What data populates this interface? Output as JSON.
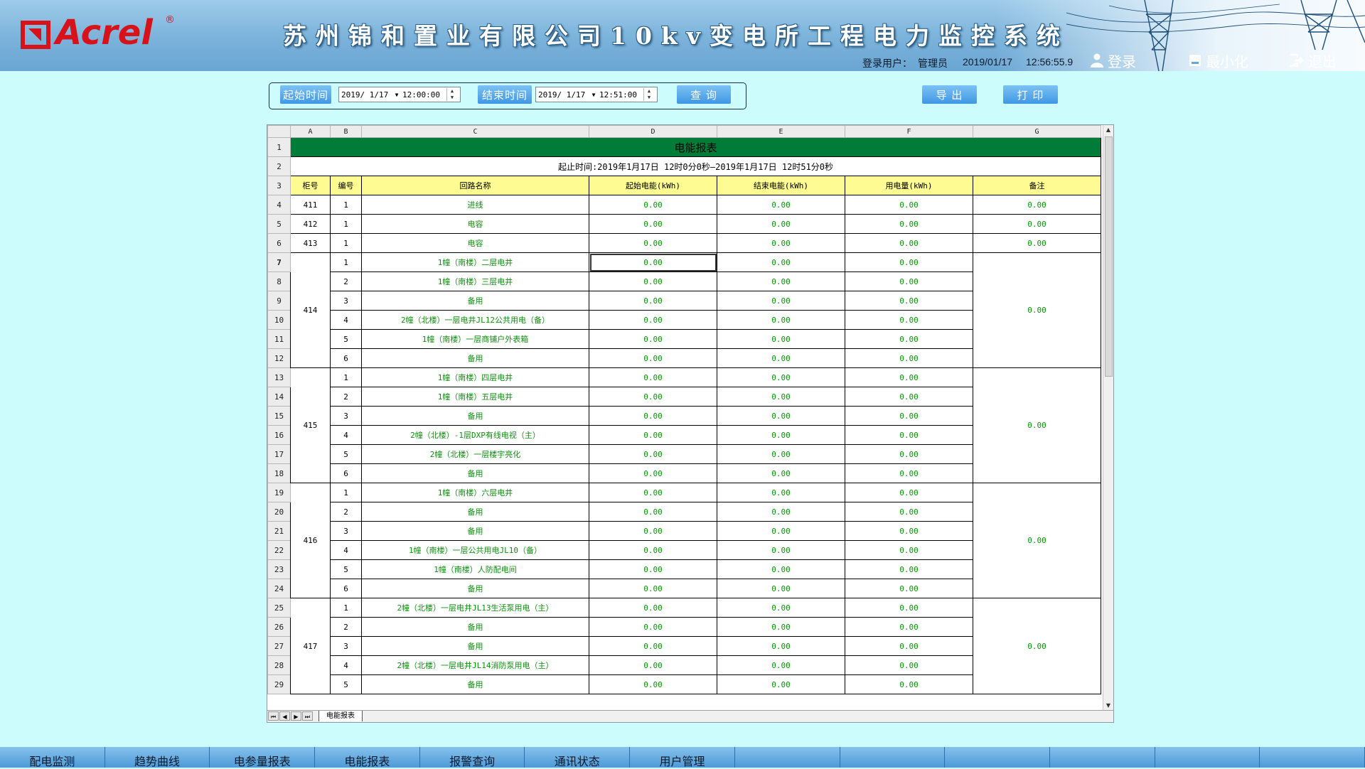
{
  "header": {
    "logo_text": "Acrel",
    "logo_registered": "®",
    "title": "苏州锦和置业有限公司10kv变电所工程电力监控系统",
    "user_label": "登录用户：",
    "user_name": "管理员",
    "date": "2019/01/17",
    "time": "12:56:55.9",
    "login_label": "登录",
    "minimize_label": "最小化",
    "exit_label": "退出"
  },
  "query": {
    "start_label": "起始时间",
    "start_date": "2019/ 1/17",
    "start_time": "12:00:00",
    "end_label": "结束时间",
    "end_date": "2019/ 1/17",
    "end_time": "12:51:00",
    "query_button": "查 询",
    "export_button": "导 出",
    "print_button": "打 印"
  },
  "sheet": {
    "column_letters": [
      "A",
      "B",
      "C",
      "D",
      "E",
      "F",
      "G"
    ],
    "title": "电能报表",
    "period": "起止时间:2019年1月17日  12时0分0秒—2019年1月17日  12时51分0秒",
    "headers": [
      "柜号",
      "编号",
      "回路名称",
      "起始电能(kWh)",
      "结束电能(kWh)",
      "用电量(kWh)",
      "备注"
    ],
    "rows": [
      {
        "row": "4",
        "cab": "411",
        "no": "1",
        "name": "进线",
        "start": "0.00",
        "end": "0.00",
        "used": "0.00",
        "remark": "0.00"
      },
      {
        "row": "5",
        "cab": "412",
        "no": "1",
        "name": "电容",
        "start": "0.00",
        "end": "0.00",
        "used": "0.00",
        "remark": "0.00"
      },
      {
        "row": "6",
        "cab": "413",
        "no": "1",
        "name": "电容",
        "start": "0.00",
        "end": "0.00",
        "used": "0.00",
        "remark": "0.00"
      },
      {
        "row": "7",
        "cab": "414",
        "no": "1",
        "name": "1幢（南楼）二层电井",
        "start": "0.00",
        "end": "0.00",
        "used": "0.00",
        "remark": "0.00"
      },
      {
        "row": "8",
        "no": "2",
        "name": "1幢（南楼）三层电井",
        "start": "0.00",
        "end": "0.00",
        "used": "0.00"
      },
      {
        "row": "9",
        "no": "3",
        "name": "备用",
        "start": "0.00",
        "end": "0.00",
        "used": "0.00"
      },
      {
        "row": "10",
        "no": "4",
        "name": "2幢（北楼）一层电井JL12公共用电（备）",
        "start": "0.00",
        "end": "0.00",
        "used": "0.00"
      },
      {
        "row": "11",
        "no": "5",
        "name": "1幢（南楼）一层商铺户外表箱",
        "start": "0.00",
        "end": "0.00",
        "used": "0.00"
      },
      {
        "row": "12",
        "no": "6",
        "name": "备用",
        "start": "0.00",
        "end": "0.00",
        "used": "0.00"
      },
      {
        "row": "13",
        "cab": "415",
        "no": "1",
        "name": "1幢（南楼）四层电井",
        "start": "0.00",
        "end": "0.00",
        "used": "0.00",
        "remark": "0.00"
      },
      {
        "row": "14",
        "no": "2",
        "name": "1幢（南楼）五层电井",
        "start": "0.00",
        "end": "0.00",
        "used": "0.00"
      },
      {
        "row": "15",
        "no": "3",
        "name": "备用",
        "start": "0.00",
        "end": "0.00",
        "used": "0.00"
      },
      {
        "row": "16",
        "no": "4",
        "name": "2幢（北楼）-1层DXP有线电视（主）",
        "start": "0.00",
        "end": "0.00",
        "used": "0.00"
      },
      {
        "row": "17",
        "no": "5",
        "name": "2幢（北楼）一层楼宇亮化",
        "start": "0.00",
        "end": "0.00",
        "used": "0.00"
      },
      {
        "row": "18",
        "no": "6",
        "name": "备用",
        "start": "0.00",
        "end": "0.00",
        "used": "0.00"
      },
      {
        "row": "19",
        "cab": "416",
        "no": "1",
        "name": "1幢（南楼）六层电井",
        "start": "0.00",
        "end": "0.00",
        "used": "0.00",
        "remark": "0.00"
      },
      {
        "row": "20",
        "no": "2",
        "name": "备用",
        "start": "0.00",
        "end": "0.00",
        "used": "0.00"
      },
      {
        "row": "21",
        "no": "3",
        "name": "备用",
        "start": "0.00",
        "end": "0.00",
        "used": "0.00"
      },
      {
        "row": "22",
        "no": "4",
        "name": "1幢（南楼）一层公共用电JL10（备）",
        "start": "0.00",
        "end": "0.00",
        "used": "0.00"
      },
      {
        "row": "23",
        "no": "5",
        "name": "1幢（南楼）人防配电间",
        "start": "0.00",
        "end": "0.00",
        "used": "0.00"
      },
      {
        "row": "24",
        "no": "6",
        "name": "备用",
        "start": "0.00",
        "end": "0.00",
        "used": "0.00"
      },
      {
        "row": "25",
        "cab": "417",
        "no": "1",
        "name": "2幢（北楼）一层电井JL13生活泵用电（主）",
        "start": "0.00",
        "end": "0.00",
        "used": "0.00",
        "remark": "0.00"
      },
      {
        "row": "26",
        "no": "2",
        "name": "备用",
        "start": "0.00",
        "end": "0.00",
        "used": "0.00"
      },
      {
        "row": "27",
        "no": "3",
        "name": "备用",
        "start": "0.00",
        "end": "0.00",
        "used": "0.00"
      },
      {
        "row": "28",
        "no": "4",
        "name": "2幢（北楼）一层电井JL14消防泵用电（主）",
        "start": "0.00",
        "end": "0.00",
        "used": "0.00"
      },
      {
        "row": "29",
        "no": "5",
        "name": "备用",
        "start": "0.00",
        "end": "0.00",
        "used": "0.00"
      }
    ],
    "tab_name": "电能报表"
  },
  "nav": {
    "items": [
      "配电监测",
      "趋势曲线",
      "电参量报表",
      "电能报表",
      "报警查询",
      "通讯状态",
      "用户管理",
      "",
      "",
      "",
      "",
      "",
      ""
    ]
  },
  "colors": {
    "background": "#cdfcfd",
    "title_band": "#007c39",
    "header_row": "#fdfb91",
    "value_text": "#0f8f0f",
    "button": "#3f97e4",
    "logo": "#d8121a"
  }
}
